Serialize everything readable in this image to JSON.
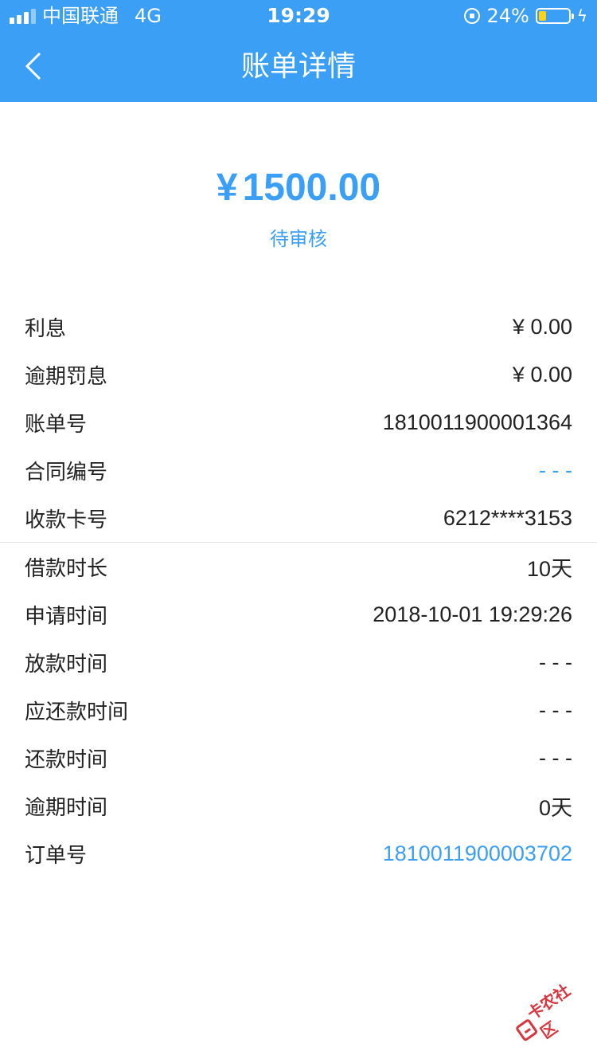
{
  "status_bar": {
    "carrier": "中国联通",
    "network": "4G",
    "time": "19:29",
    "battery_percent": "24%",
    "battery_level": 0.24,
    "signal_bars": 3
  },
  "nav": {
    "title": "账单详情",
    "back_icon": "chevron-left-icon"
  },
  "summary": {
    "currency": "¥",
    "amount": "1500.00",
    "status": "待审核"
  },
  "group1": [
    {
      "label": "利息",
      "value": "¥ 0.00",
      "highlight": false
    },
    {
      "label": "逾期罚息",
      "value": "¥ 0.00",
      "highlight": false
    },
    {
      "label": "账单号",
      "value": "1810011900001364",
      "highlight": false
    },
    {
      "label": "合同编号",
      "value": "- - -",
      "highlight": true
    },
    {
      "label": "收款卡号",
      "value": "6212****3153",
      "highlight": false
    }
  ],
  "group2": [
    {
      "label": "借款时长",
      "value": "10天",
      "highlight": false
    },
    {
      "label": "申请时间",
      "value": "2018-10-01 19:29:26",
      "highlight": false
    },
    {
      "label": "放款时间",
      "value": "- - -",
      "highlight": false
    },
    {
      "label": "应还款时间",
      "value": "- - -",
      "highlight": false
    },
    {
      "label": "还款时间",
      "value": "- - -",
      "highlight": false
    },
    {
      "label": "逾期时间",
      "value": "0天",
      "highlight": false
    },
    {
      "label": "订单号",
      "value": "1810011900003702",
      "highlight": true
    }
  ],
  "watermark": {
    "text": "卡农社区"
  },
  "colors": {
    "accent": "#3a9ff5",
    "battery": "#ffd21a",
    "watermark": "#d9353e"
  }
}
